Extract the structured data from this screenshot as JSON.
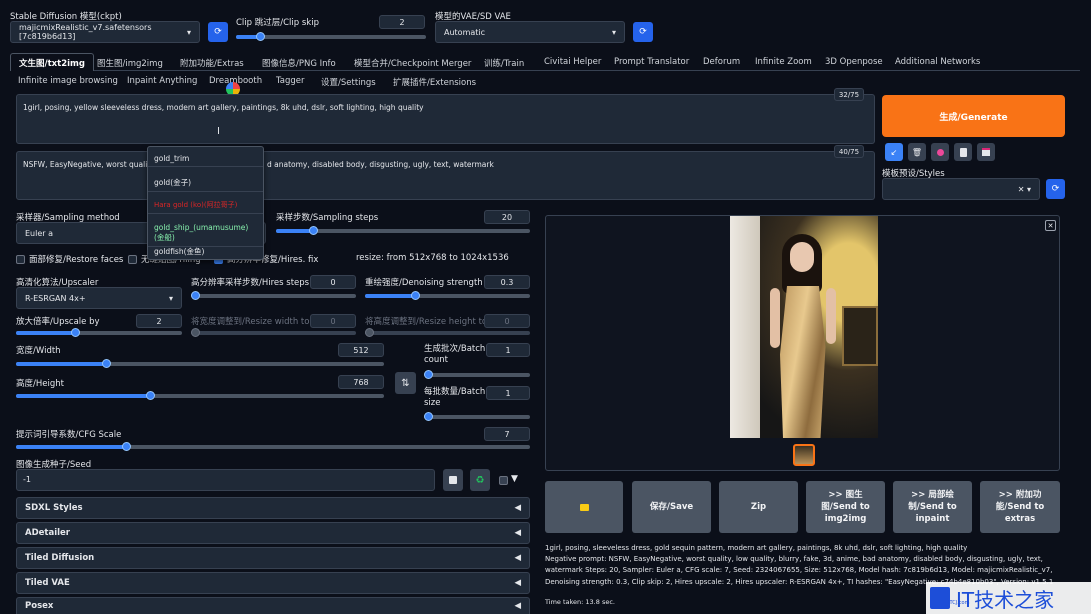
{
  "top": {
    "checkpoint_label": "Stable Diffusion 模型(ckpt)",
    "checkpoint_value": "majicmixRealistic_v7.safetensors [7c819b6d13]",
    "clip_label": "Clip 跳过层/Clip skip",
    "clip_value": "2",
    "vae_label": "模型的VAE/SD VAE",
    "vae_value": "Automatic"
  },
  "tabs": [
    "文生图/txt2img",
    "图生图/img2img",
    "附加功能/Extras",
    "图像信息/PNG Info",
    "模型合并/Checkpoint Merger",
    "训练/Train",
    "Civitai Helper",
    "Prompt Translator",
    "Deforum",
    "Infinite Zoom",
    "3D Openpose",
    "Additional Networks"
  ],
  "tabs2": [
    "Infinite image browsing",
    "Inpaint Anything",
    "Dreambooth",
    "Tagger",
    "设置/Settings",
    "扩展插件/Extensions"
  ],
  "prompt": {
    "text": "1girl, posing, yellow sleeveless dress, modern art gallery, paintings, 8k uhd, dslr, soft lighting, high quality",
    "count": "32/75",
    "neg_text_a": "NSFW, EasyNegative, worst quality, lo",
    "neg_text_b": "d anatomy, disabled body, disgusting, ugly, text, watermark",
    "neg_count": "40/75"
  },
  "autocomplete": [
    "gold_trim",
    "gold(金子)",
    "Hara gold (ko)(阿拉哥子)",
    "gold_ship_(umamusume)(金船)",
    "goldfish(金鱼)"
  ],
  "generate_label": "生成/Generate",
  "styles_label": "模板预设/Styles",
  "sampling": {
    "method_label": "采样器/Sampling method",
    "method_value": "Euler a",
    "steps_label": "采样步数/Sampling steps",
    "steps_value": "20"
  },
  "options": {
    "restore_faces": "面部修复/Restore faces",
    "tiling": "无缝贴图/Tiling",
    "hires": "高分辨率修复/Hires. fix",
    "resize_info": "resize: from 512x768 to 1024x1536"
  },
  "hires": {
    "upscaler_label": "高清化算法/Upscaler",
    "upscaler_value": "R-ESRGAN 4x+",
    "steps_label": "高分辨率采样步数/Hires steps",
    "steps_value": "0",
    "denoise_label": "重绘强度/Denoising strength",
    "denoise_value": "0.3",
    "upscale_label": "放大倍率/Upscale by",
    "upscale_value": "2",
    "resize_w_label": "将宽度调整到/Resize width to",
    "resize_w_value": "0",
    "resize_h_label": "将高度调整到/Resize height to",
    "resize_h_value": "0"
  },
  "size": {
    "width_label": "宽度/Width",
    "width_value": "512",
    "height_label": "高度/Height",
    "height_value": "768",
    "batch_count_label": "生成批次/Batch count",
    "batch_count_value": "1",
    "batch_size_label": "每批数量/Batch size",
    "batch_size_value": "1"
  },
  "cfg": {
    "label": "提示词引导系数/CFG Scale",
    "value": "7"
  },
  "seed": {
    "label": "图像生成种子/Seed",
    "value": "-1"
  },
  "accordions": [
    "SDXL Styles",
    "ADetailer",
    "Tiled Diffusion",
    "Tiled VAE",
    "Posex"
  ],
  "actions": {
    "save": "保存/Save",
    "zip": "Zip",
    "img2img": ">> 图生图/Send to img2img",
    "inpaint": ">> 局部绘制/Send to inpaint",
    "extras": ">> 附加功能/Send to extras"
  },
  "info": {
    "prompt": "1girl, posing, sleeveless dress, gold sequin pattern, modern art gallery, paintings, 8k uhd, dslr, soft lighting, high quality",
    "params": "Negative prompt: NSFW, EasyNegative, worst quality, low quality, blurry, fake, 3d, anime, bad anatomy, disabled body, disgusting, ugly, text, watermark Steps: 20, Sampler: Euler a, CFG scale: 7, Seed: 2324067655, Size: 512x768, Model hash: 7c819b6d13, Model: majicmixRealistic_v7, Denoising strength: 0.3, Clip skip: 2, Hires upscale: 2, Hires upscaler: R-ESRGAN 4x+, TI hashes: \"EasyNegative: c74b4e810b03\", Version: v1.5.1",
    "time": "Time taken: 13.8 sec."
  },
  "watermark": "IT技术之家",
  "watermark_domain": "ITCJ.com",
  "colors": {
    "accent": "#3b82f6",
    "generate": "#f97316"
  }
}
